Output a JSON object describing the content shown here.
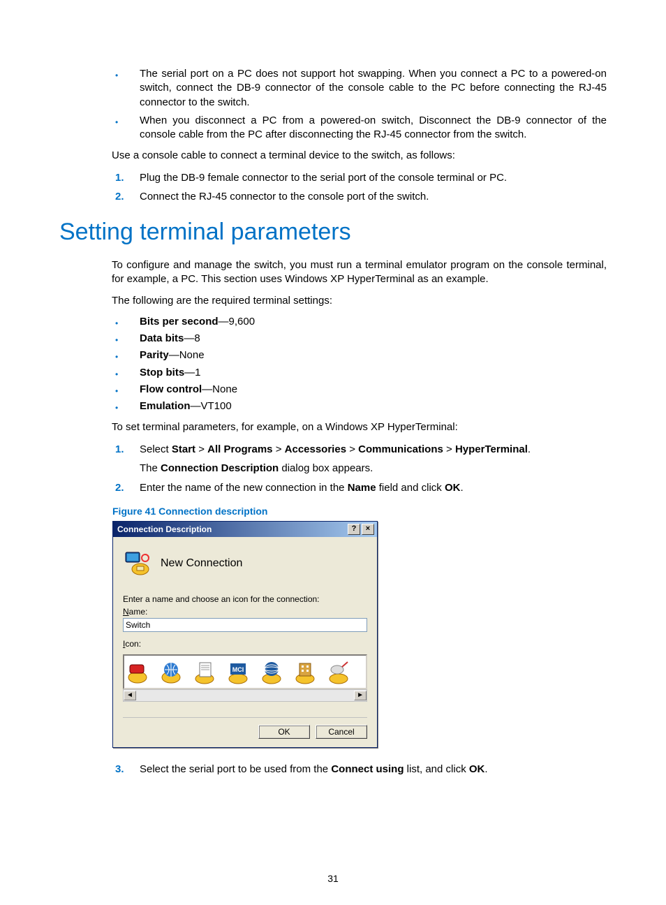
{
  "bullets_top": [
    "The serial port on a PC does not support hot swapping. When you connect a PC to a powered-on switch, connect the DB-9 connector of the console cable to the PC before connecting the RJ-45 connector to the switch.",
    "When you disconnect a PC from a powered-on switch, Disconnect the DB-9 connector of the console cable from the PC after disconnecting the RJ-45 connector from the switch."
  ],
  "intro_line": "Use a console cable to connect a terminal device to the switch, as follows:",
  "steps_top": [
    "Plug the DB-9 female connector to the serial port of the console terminal or PC.",
    "Connect the RJ-45 connector to the console port of the switch."
  ],
  "heading": "Setting terminal parameters",
  "para1": "To configure and manage the switch, you must run a terminal emulator program on the console terminal, for example, a PC. This section uses Windows XP HyperTerminal as an example.",
  "para2": "The following are the required terminal settings:",
  "settings": [
    {
      "label": "Bits per second",
      "value": "—9,600"
    },
    {
      "label": "Data bits",
      "value": "—8"
    },
    {
      "label": "Parity",
      "value": "—None"
    },
    {
      "label": "Stop bits",
      "value": "—1"
    },
    {
      "label": "Flow control",
      "value": "—None"
    },
    {
      "label": "Emulation",
      "value": "—VT100"
    }
  ],
  "para3": "To set terminal parameters, for example, on a Windows XP HyperTerminal:",
  "steps_main": [
    {
      "pre": "Select ",
      "bold_sequence": [
        "Start",
        "All Programs",
        "Accessories",
        "Communications",
        "HyperTerminal"
      ],
      "sep": " > ",
      "post": ".",
      "sub_pre": "The ",
      "sub_bold": "Connection Description",
      "sub_post": " dialog box appears."
    },
    {
      "pre": "Enter the name of the new connection in the ",
      "bold1": "Name",
      "mid": " field and click ",
      "bold2": "OK",
      "post": "."
    }
  ],
  "figure_caption": "Figure 41 Connection description",
  "dialog": {
    "title": "Connection Description",
    "help_btn": "?",
    "close_btn": "×",
    "new_connection_label": "New Connection",
    "prompt": "Enter a name and choose an icon for the connection:",
    "name_label": "Name:",
    "name_value": "Switch",
    "icon_label": "Icon:",
    "ok": "OK",
    "cancel": "Cancel"
  },
  "step3": {
    "pre": "Select the serial port to be used from the ",
    "bold1": "Connect using",
    "mid": " list, and click ",
    "bold2": "OK",
    "post": "."
  },
  "page_number": "31"
}
